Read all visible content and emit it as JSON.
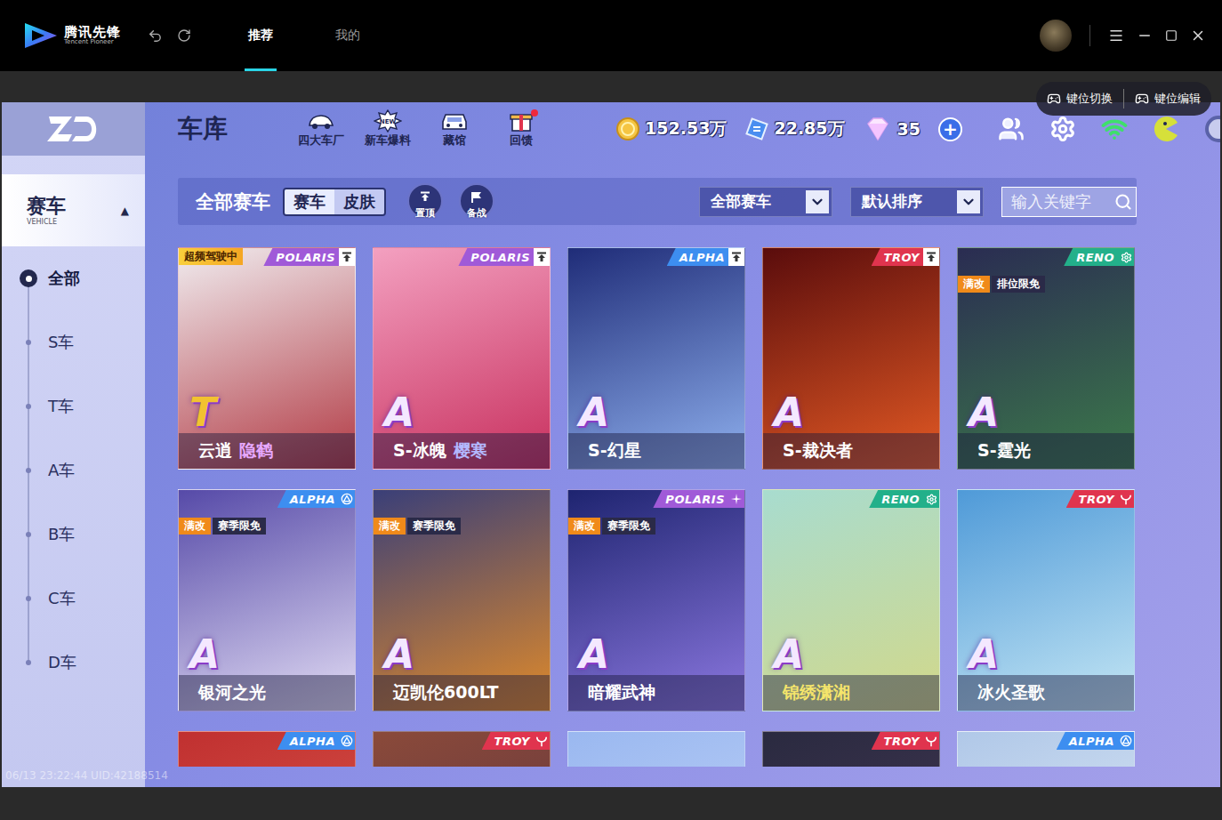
{
  "app": {
    "name": "腾讯先锋",
    "subtitle": "Tencent Pioneer"
  },
  "top_tabs": [
    {
      "label": "推荐",
      "selected": true
    },
    {
      "label": "我的",
      "selected": false
    }
  ],
  "overlay_buttons": [
    "键位切换",
    "键位编辑"
  ],
  "sidebar": {
    "section": {
      "label": "赛车",
      "sublabel": "VEHICLE",
      "expanded": true,
      "arrow": "▲"
    },
    "items": [
      {
        "label": "全部",
        "selected": true
      },
      {
        "label": "S车",
        "selected": false
      },
      {
        "label": "T车",
        "selected": false
      },
      {
        "label": "A车",
        "selected": false
      },
      {
        "label": "B车",
        "selected": false
      },
      {
        "label": "C车",
        "selected": false
      },
      {
        "label": "D车",
        "selected": false
      }
    ]
  },
  "header": {
    "title": "车库",
    "nav": [
      {
        "label": "四大车厂",
        "kind": "factory",
        "badge": false
      },
      {
        "label": "新车爆料",
        "kind": "news",
        "badge": false,
        "icon_text": "NEW"
      },
      {
        "label": "藏馆",
        "kind": "museum",
        "badge": false
      },
      {
        "label": "回馈",
        "kind": "gift",
        "badge": true
      }
    ],
    "currencies": [
      {
        "kind": "coin",
        "amount": "152.53万"
      },
      {
        "kind": "ticket",
        "amount": "22.85万"
      },
      {
        "kind": "diamond",
        "amount": "35"
      }
    ],
    "add_button": "+"
  },
  "filter": {
    "title": "全部赛车",
    "segments": [
      {
        "label": "赛车",
        "selected": true
      },
      {
        "label": "皮肤",
        "selected": false
      }
    ],
    "actions": [
      {
        "label": "置顶",
        "kind": "pin"
      },
      {
        "label": "备战",
        "kind": "flag"
      }
    ],
    "dropdowns": [
      "全部赛车",
      "默认排序"
    ],
    "search_placeholder": "输入关键字"
  },
  "cars": [
    {
      "name": "云逍",
      "name_color": "#ffffff",
      "skin": "隐鹤",
      "skin_color": "#e7a8ff",
      "brand": "POLARIS",
      "color": "#a05ad8",
      "pinned": true,
      "grade": "T",
      "grade_color": "#f2c230",
      "badges": [
        {
          "label": "超频驾驶中",
          "kind": "status",
          "color": "#f5a623"
        }
      ],
      "art": [
        "#f0ecef",
        "#b23a44"
      ]
    },
    {
      "name": "S-冰魄",
      "name_color": "#ffffff",
      "skin": "樱寒",
      "skin_color": "#b3b8ff",
      "brand": "POLARIS",
      "color": "#a05ad8",
      "pinned": true,
      "grade": "A",
      "grade_color": "#f4e8ff",
      "badges": [],
      "art": [
        "#f3a0c0",
        "#c8305e"
      ]
    },
    {
      "name": "S-幻星",
      "name_color": "#ffffff",
      "brand": "ALPHA",
      "color": "#3d8ef0",
      "pinned": true,
      "grade": "A",
      "grade_color": "#f4e8ff",
      "badges": [],
      "art": [
        "#1f2c78",
        "#8fb0ee"
      ]
    },
    {
      "name": "S-裁决者",
      "name_color": "#ffffff",
      "brand": "TROY",
      "color": "#e0344e",
      "pinned": true,
      "grade": "A",
      "grade_color": "#f4e8ff",
      "badges": [],
      "art": [
        "#5a0c0c",
        "#e45a24"
      ]
    },
    {
      "name": "S-霆光",
      "name_color": "#ffffff",
      "brand": "RENO",
      "color": "#23b08a",
      "pinned": false,
      "grade": "A",
      "grade_color": "#f4e8ff",
      "badges": [
        {
          "label": "满改",
          "kind": "perk",
          "color": "#f08a1a"
        },
        {
          "label": "排位限免",
          "kind": "perk",
          "color": "#2a2a48"
        }
      ],
      "art": [
        "#2a2c52",
        "#3c7a4a"
      ]
    },
    {
      "name": "银河之光",
      "name_color": "#ffffff",
      "brand": "ALPHA",
      "color": "#3d8ef0",
      "pinned": false,
      "grade": "A",
      "grade_color": "#f4e8ff",
      "badges": [
        {
          "label": "满改",
          "kind": "perk",
          "color": "#f08a1a"
        },
        {
          "label": "赛季限免",
          "kind": "perk",
          "color": "#2a2a48"
        }
      ],
      "art": [
        "#564aa8",
        "#e2dcf4"
      ]
    },
    {
      "name": "迈凯伦600LT",
      "name_color": "#ffffff",
      "pinned": false,
      "grade": "A",
      "grade_color": "#f4e8ff",
      "badges": [
        {
          "label": "满改",
          "kind": "perk",
          "color": "#f08a1a"
        },
        {
          "label": "赛季限免",
          "kind": "perk",
          "color": "#2a2a48"
        }
      ],
      "art": [
        "#3a3f78",
        "#e08a2a"
      ]
    },
    {
      "name": "暗耀武神",
      "name_color": "#ffffff",
      "brand": "POLARIS",
      "color": "#a05ad8",
      "pinned": false,
      "grade": "A",
      "grade_color": "#f4e8ff",
      "badges": [
        {
          "label": "满改",
          "kind": "perk",
          "color": "#f08a1a"
        },
        {
          "label": "赛季限免",
          "kind": "perk",
          "color": "#2a2a48"
        }
      ],
      "art": [
        "#1e2470",
        "#8c78e0"
      ]
    },
    {
      "name": "锦绣潇湘",
      "name_color": "#f5e56b",
      "brand": "RENO",
      "color": "#23b08a",
      "pinned": false,
      "grade": "A",
      "grade_color": "#f4e8ff",
      "badges": [],
      "art": [
        "#a8dccf",
        "#d2d88a"
      ]
    },
    {
      "name": "冰火圣歌",
      "name_color": "#ffffff",
      "brand": "TROY",
      "color": "#e0344e",
      "pinned": false,
      "grade": "A",
      "grade_color": "#f4e8ff",
      "badges": [],
      "art": [
        "#4f9ad8",
        "#c4e6f4"
      ]
    },
    {
      "brand": "ALPHA",
      "color": "#3d8ef0",
      "pinned": false,
      "badges": [],
      "art": [
        "#c03030",
        "#e06050"
      ]
    },
    {
      "brand": "TROY",
      "color": "#e0344e",
      "pinned": false,
      "badges": [],
      "art": [
        "#8a4a3a",
        "#5a3040"
      ]
    },
    {
      "pinned": false,
      "badges": [],
      "art": [
        "#9ab8f0",
        "#c8d8f8"
      ]
    },
    {
      "brand": "TROY",
      "color": "#e0344e",
      "pinned": false,
      "badges": [],
      "art": [
        "#2a2a40",
        "#4a3a58"
      ]
    },
    {
      "brand": "ALPHA",
      "color": "#3d8ef0",
      "pinned": false,
      "badges": [],
      "art": [
        "#b0c8e8",
        "#e8f0f8"
      ]
    }
  ],
  "watermark": "06/13 23:22:44 UID:42188514"
}
